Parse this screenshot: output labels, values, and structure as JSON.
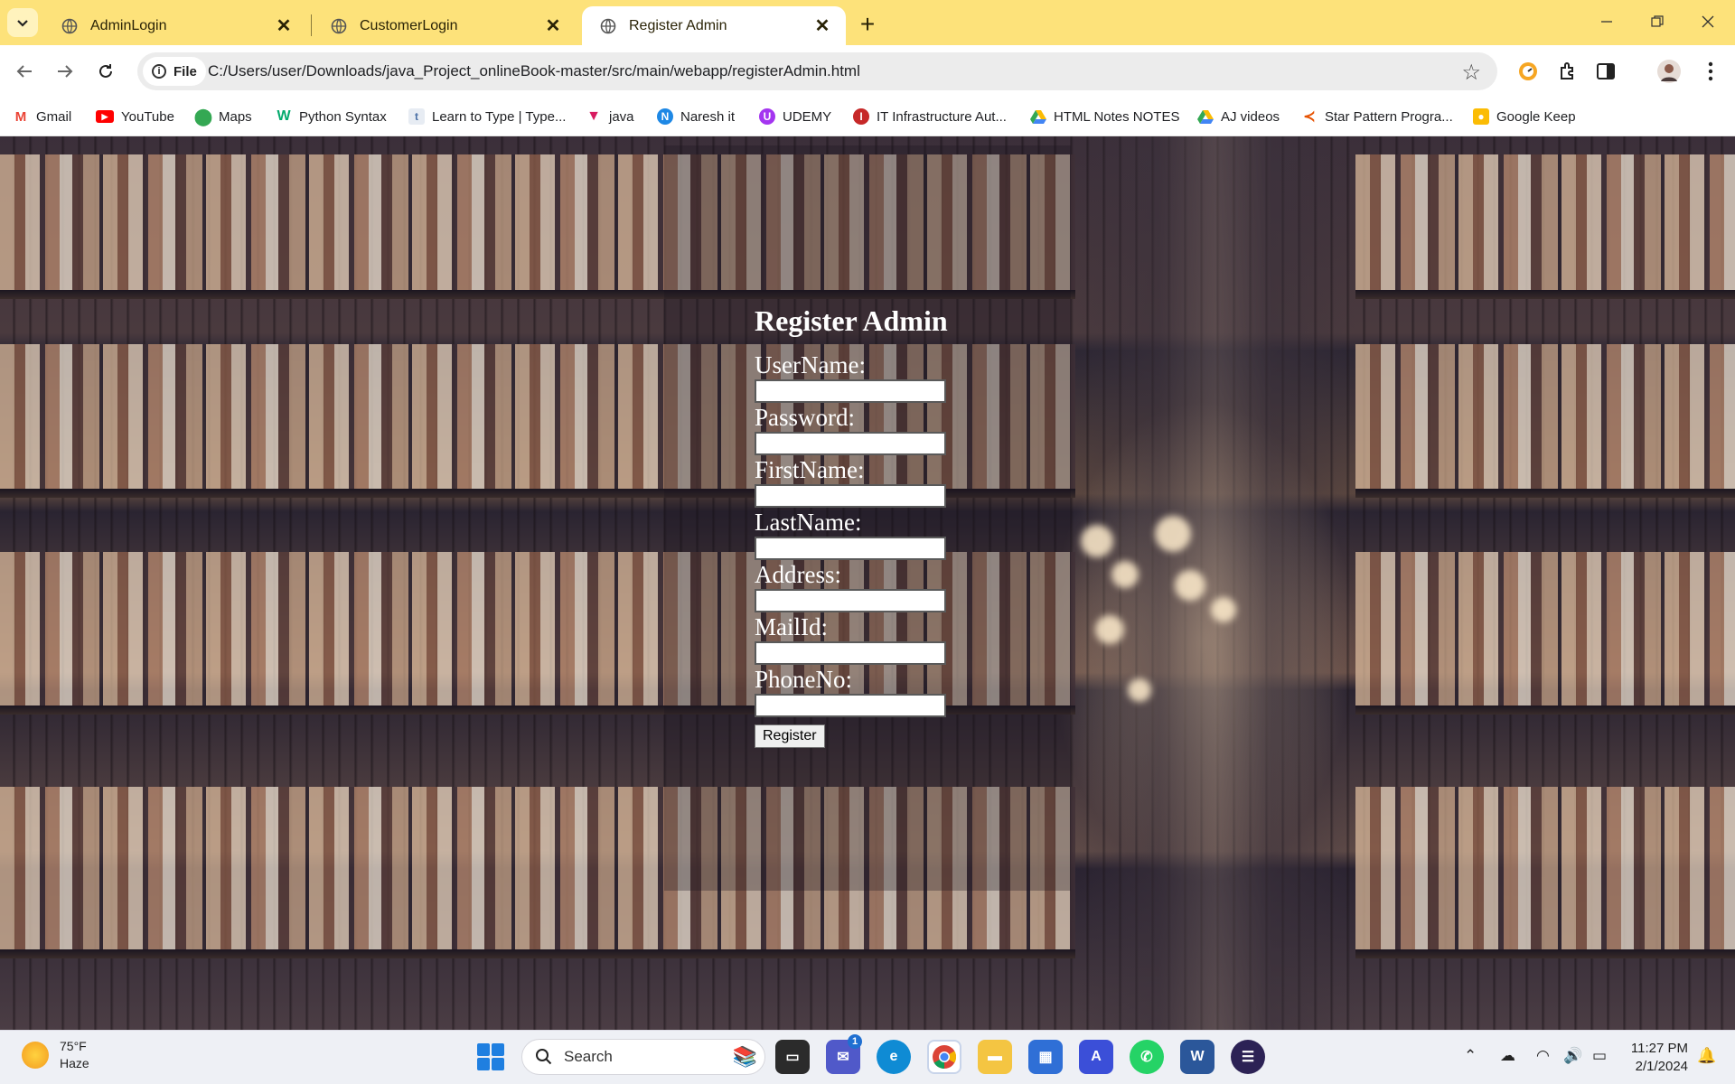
{
  "browser": {
    "tabs": [
      {
        "title": "AdminLogin",
        "active": false
      },
      {
        "title": "CustomerLogin",
        "active": false
      },
      {
        "title": "Register Admin",
        "active": true
      }
    ],
    "address_chip": "File",
    "url": "C:/Users/user/Downloads/java_Project_onlineBook-master/src/main/webapp/registerAdmin.html",
    "bookmarks": [
      {
        "label": "Gmail",
        "icon": "gmail-icon",
        "color": "#ea4335"
      },
      {
        "label": "YouTube",
        "icon": "youtube-icon",
        "color": "#ff0000"
      },
      {
        "label": "Maps",
        "icon": "maps-icon",
        "color": "#34a853"
      },
      {
        "label": "Python Syntax",
        "icon": "w3-icon",
        "color": "#04aa6d"
      },
      {
        "label": "Learn to Type | Type...",
        "icon": "typing-icon",
        "color": "#4a6fa5"
      },
      {
        "label": "java",
        "icon": "java-icon",
        "color": "#d81b60"
      },
      {
        "label": "Naresh it",
        "icon": "nareshit-icon",
        "color": "#1e88e5"
      },
      {
        "label": "UDEMY",
        "icon": "udemy-icon",
        "color": "#a435f0"
      },
      {
        "label": "IT Infrastructure Aut...",
        "icon": "infra-icon",
        "color": "#c62828"
      },
      {
        "label": "HTML Notes NOTES",
        "icon": "drive-icon",
        "color": "#fbbc04"
      },
      {
        "label": "AJ videos",
        "icon": "drive-icon",
        "color": "#fbbc04"
      },
      {
        "label": "Star Pattern Progra...",
        "icon": "pattern-icon",
        "color": "#e65100"
      },
      {
        "label": "Google Keep",
        "icon": "keep-icon",
        "color": "#fbbc04"
      }
    ]
  },
  "page": {
    "heading": "Register Admin",
    "fields": [
      {
        "label": "UserName:",
        "value": ""
      },
      {
        "label": "Password:",
        "value": ""
      },
      {
        "label": "FirstName:",
        "value": ""
      },
      {
        "label": "LastName:",
        "value": ""
      },
      {
        "label": "Address:",
        "value": ""
      },
      {
        "label": "MailId:",
        "value": ""
      },
      {
        "label": "PhoneNo:",
        "value": ""
      }
    ],
    "submit_label": "Register"
  },
  "taskbar": {
    "weather_temp": "75°F",
    "weather_desc": "Haze",
    "search_placeholder": "Search",
    "teams_badge": "1",
    "time": "11:27 PM",
    "date": "2/1/2024"
  }
}
